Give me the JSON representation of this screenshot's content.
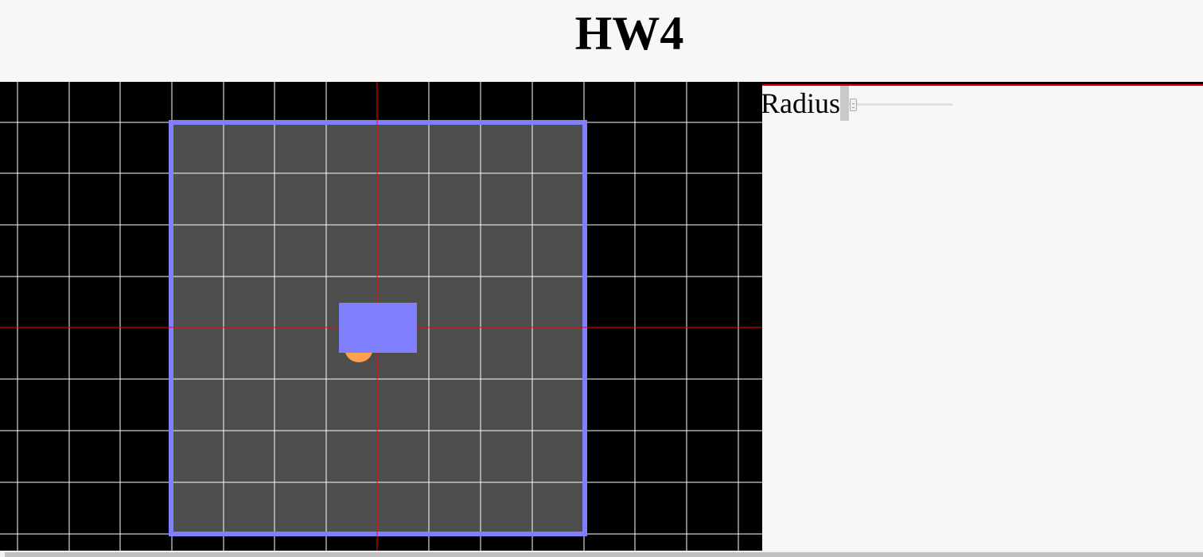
{
  "page": {
    "title": "HW4"
  },
  "controls": {
    "radius_label": "Radius",
    "radius_slider": {
      "value": 0
    }
  },
  "scene": {
    "background_color": "#000000",
    "grid_color": "#ffffff",
    "axis_color": "#ff0000",
    "floor_color": "#4e4e4e",
    "floor_border_color": "#8080ff",
    "box_color": "#8080ff",
    "ball_color": "#ffa050"
  }
}
